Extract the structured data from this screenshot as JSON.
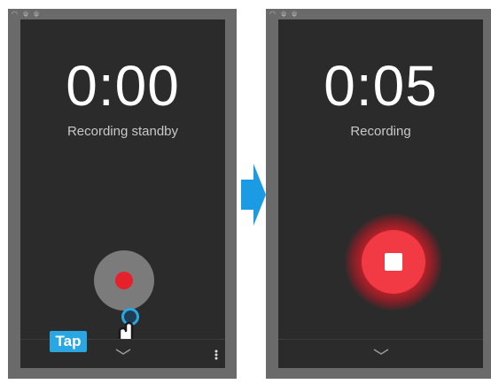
{
  "left_screen": {
    "timer": "0:00",
    "status": "Recording standby",
    "tap_label": "Tap"
  },
  "right_screen": {
    "timer": "0:05",
    "status": "Recording"
  },
  "colors": {
    "record_red": "#e5222c",
    "stop_red": "#f23a44",
    "tap_blue": "#2aa7e2",
    "arrow_blue": "#1a9be3",
    "screen_bg": "#2b2b2b"
  }
}
